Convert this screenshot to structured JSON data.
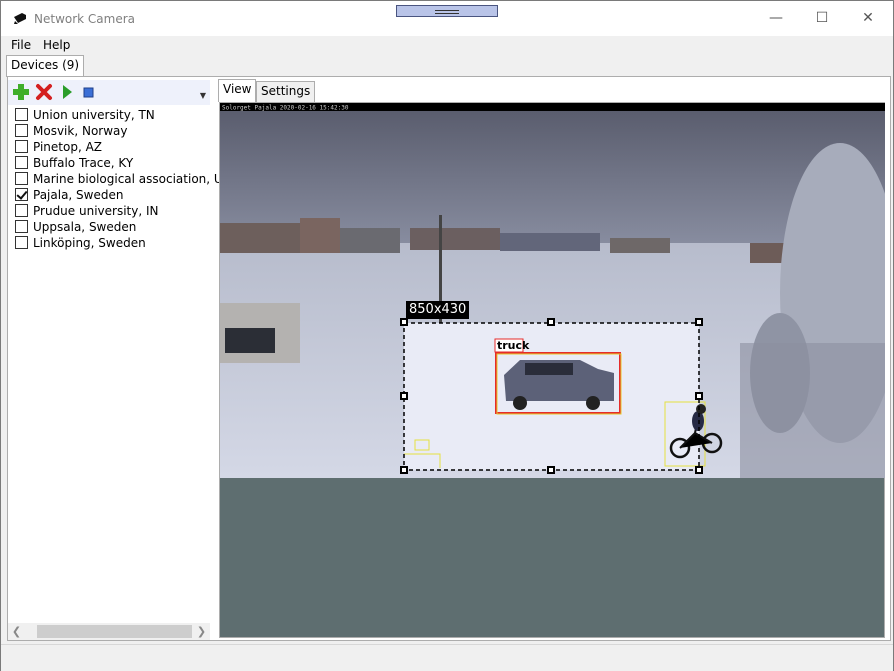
{
  "window": {
    "title": "Network Camera"
  },
  "menu": {
    "file": "File",
    "help": "Help"
  },
  "main_tab": {
    "label": "Devices (9)"
  },
  "toolbar": {
    "add_icon": "plus-icon",
    "remove_icon": "x-icon",
    "play_icon": "play-icon",
    "stop_icon": "stop-icon"
  },
  "devices": [
    {
      "label": "Union university, TN",
      "checked": false
    },
    {
      "label": "Mosvik, Norway",
      "checked": false
    },
    {
      "label": "Pinetop, AZ",
      "checked": false
    },
    {
      "label": "Buffalo Trace, KY",
      "checked": false
    },
    {
      "label": "Marine biological association, UK",
      "checked": false
    },
    {
      "label": "Pajala, Sweden",
      "checked": true
    },
    {
      "label": "Prudue university, IN",
      "checked": false
    },
    {
      "label": "Uppsala, Sweden",
      "checked": false
    },
    {
      "label": "Linköping, Sweden",
      "checked": false
    }
  ],
  "view_tabs": {
    "view": "View",
    "settings": "Settings"
  },
  "camera": {
    "overlay_text": "Solorget Pajala  2020-02-16 15:42:30",
    "selection_size": "850x430",
    "detection_label": "truck"
  }
}
